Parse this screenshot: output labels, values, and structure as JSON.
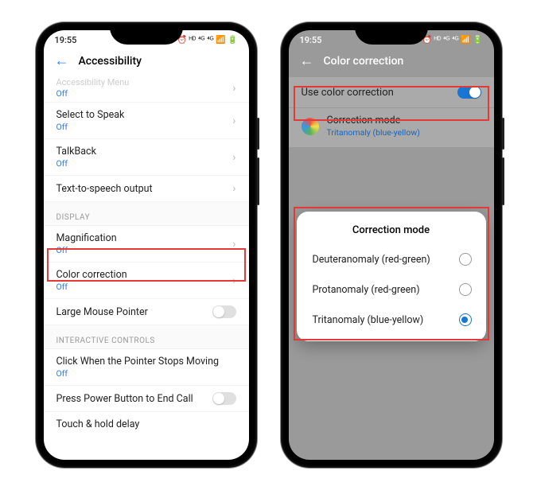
{
  "status": {
    "time": "19:55",
    "icons": "⏰ ᴴᴰ ⁴ᴳ ⁴ᴳ 📶 🔋"
  },
  "phone1": {
    "title": "Accessibility",
    "truncated": {
      "title": "Accessibility Menu",
      "sub": "Off"
    },
    "rows": [
      {
        "title": "Select to Speak",
        "sub": "Off",
        "chevron": true
      },
      {
        "title": "TalkBack",
        "sub": "Off",
        "chevron": true
      },
      {
        "title": "Text-to-speech output",
        "chevron": true
      }
    ],
    "section_display": "DISPLAY",
    "display_rows": {
      "magnification": {
        "title": "Magnification",
        "sub": "Off"
      },
      "color_correction": {
        "title": "Color correction",
        "sub": "Off"
      },
      "large_mouse": {
        "title": "Large Mouse Pointer"
      }
    },
    "section_interactive": "INTERACTIVE CONTROLS",
    "interactive_rows": {
      "click_pointer": {
        "title": "Click When the Pointer Stops Moving",
        "sub": "Off"
      },
      "power_end_call": {
        "title": "Press Power Button to End Call"
      },
      "touch_hold": {
        "title": "Touch & hold delay"
      }
    }
  },
  "phone2": {
    "title": "Color correction",
    "use_cc": "Use color correction",
    "mode_label": "Correction mode",
    "mode_value": "Tritanomaly (blue-yellow)",
    "dialog_title": "Correction mode",
    "options": [
      {
        "label": "Deuteranomaly (red-green)",
        "checked": false
      },
      {
        "label": "Protanomaly (red-green)",
        "checked": false
      },
      {
        "label": "Tritanomaly (blue-yellow)",
        "checked": true
      }
    ]
  }
}
